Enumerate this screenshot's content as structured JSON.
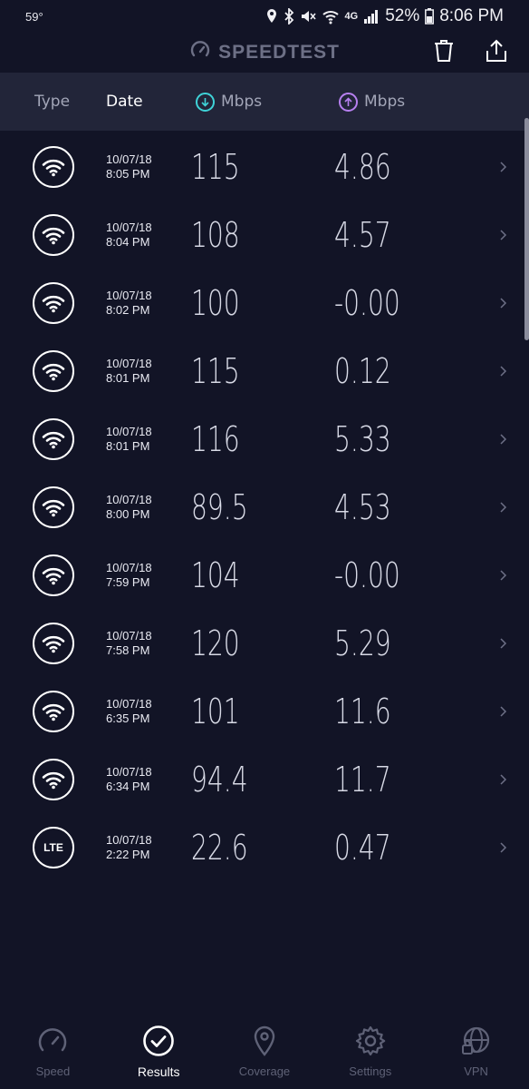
{
  "status_bar": {
    "temperature": "59°",
    "network": "4G",
    "battery": "52%",
    "time": "8:06 PM"
  },
  "header": {
    "title": "SPEEDTEST",
    "actions": [
      "trash-icon",
      "share-icon"
    ]
  },
  "columns": {
    "type": "Type",
    "date": "Date",
    "download": "Mbps",
    "upload": "Mbps"
  },
  "results": [
    {
      "type": "wifi",
      "date": "10/07/18",
      "time": "8:05 PM",
      "download": "115",
      "upload": "4.86"
    },
    {
      "type": "wifi",
      "date": "10/07/18",
      "time": "8:04 PM",
      "download": "108",
      "upload": "4.57"
    },
    {
      "type": "wifi",
      "date": "10/07/18",
      "time": "8:02 PM",
      "download": "100",
      "upload": "-0.00"
    },
    {
      "type": "wifi",
      "date": "10/07/18",
      "time": "8:01 PM",
      "download": "115",
      "upload": "0.12"
    },
    {
      "type": "wifi",
      "date": "10/07/18",
      "time": "8:01 PM",
      "download": "116",
      "upload": "5.33"
    },
    {
      "type": "wifi",
      "date": "10/07/18",
      "time": "8:00 PM",
      "download": "89.5",
      "upload": "4.53"
    },
    {
      "type": "wifi",
      "date": "10/07/18",
      "time": "7:59 PM",
      "download": "104",
      "upload": "-0.00"
    },
    {
      "type": "wifi",
      "date": "10/07/18",
      "time": "7:58 PM",
      "download": "120",
      "upload": "5.29"
    },
    {
      "type": "wifi",
      "date": "10/07/18",
      "time": "6:35 PM",
      "download": "101",
      "upload": "11.6"
    },
    {
      "type": "wifi",
      "date": "10/07/18",
      "time": "6:34 PM",
      "download": "94.4",
      "upload": "11.7"
    },
    {
      "type": "lte",
      "type_label": "LTE",
      "date": "10/07/18",
      "time": "2:22 PM",
      "download": "22.6",
      "upload": "0.47"
    }
  ],
  "nav": [
    {
      "label": "Speed",
      "icon": "speedometer-icon",
      "active": false
    },
    {
      "label": "Results",
      "icon": "check-circle-icon",
      "active": true
    },
    {
      "label": "Coverage",
      "icon": "map-pin-icon",
      "active": false
    },
    {
      "label": "Settings",
      "icon": "gear-icon",
      "active": false
    },
    {
      "label": "VPN",
      "icon": "globe-lock-icon",
      "active": false
    }
  ],
  "colors": {
    "background": "#121426",
    "header_band": "#222539",
    "download_accent": "#3fd3d8",
    "upload_accent": "#b780f0"
  }
}
